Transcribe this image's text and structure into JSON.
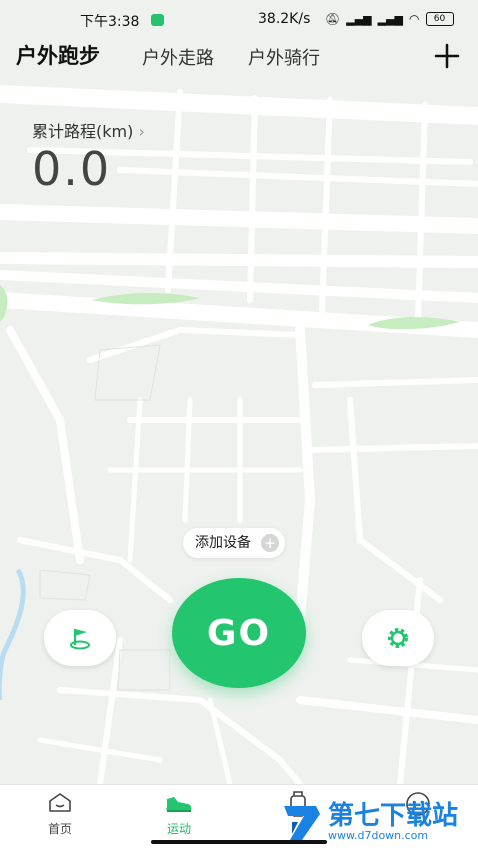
{
  "status_bar": {
    "time": "下午3:38",
    "net_speed": "38.2K/s",
    "battery": "60"
  },
  "tabs": [
    {
      "label": "户外跑步",
      "active": true
    },
    {
      "label": "户外走路",
      "active": false
    },
    {
      "label": "户外骑行",
      "active": false
    }
  ],
  "stats": {
    "label": "累计路程(km)",
    "value": "0.0"
  },
  "add_device": {
    "label": "添加设备"
  },
  "go_button": {
    "label": "GO"
  },
  "bottom_nav": [
    {
      "label": "首页",
      "icon": "home-face-icon",
      "active": false
    },
    {
      "label": "运动",
      "icon": "shoe-icon",
      "active": true
    },
    {
      "label": "",
      "icon": "watch-icon",
      "active": false
    },
    {
      "label": "",
      "icon": "smile-icon",
      "active": false
    }
  ],
  "watermark": {
    "title": "第七下载站",
    "url": "www.d7down.com"
  },
  "colors": {
    "accent": "#23c56e",
    "nav_active": "#1fb764",
    "watermark": "#1a82e2"
  }
}
